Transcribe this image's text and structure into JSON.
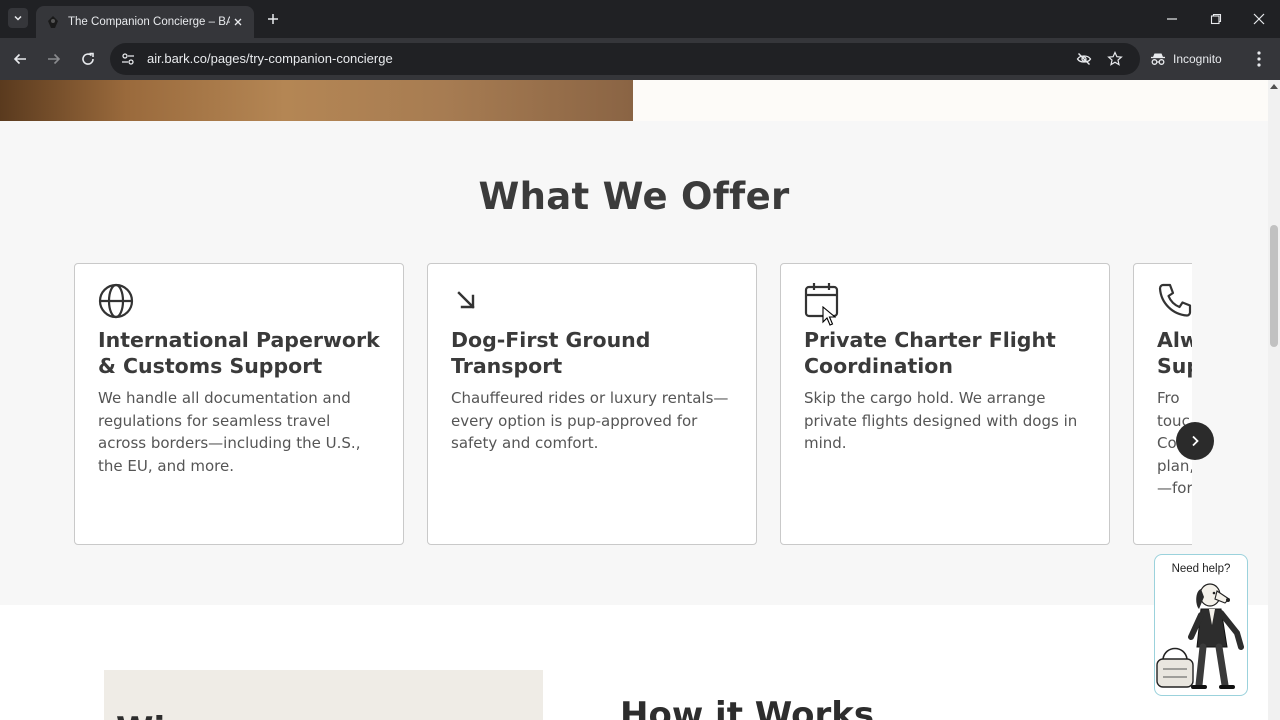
{
  "browser": {
    "tab_title": "The Companion Concierge – BA",
    "url": "air.bark.co/pages/try-companion-concierge",
    "incognito_label": "Incognito"
  },
  "page": {
    "section_title": "What We Offer",
    "cards": [
      {
        "icon": "globe-icon",
        "title": "International Paperwork & Customs Support",
        "text": "We handle all documentation and regulations for seamless travel across borders—including the U.S., the EU, and more."
      },
      {
        "icon": "arrow-down-right-icon",
        "title": "Dog-First Ground Transport",
        "text": "Chauffeured rides or luxury rentals—every option is pup-approved for safety and comfort."
      },
      {
        "icon": "calendar-icon",
        "title": "Private Charter Flight Coordination",
        "text": "Skip the cargo hold. We arrange private flights designed with dogs in mind."
      },
      {
        "icon": "phone-icon",
        "title": "Alw Sup",
        "text": "Fro touc Com plan, —for"
      }
    ],
    "next_section_title": "How it Works",
    "image_peek_text": "Wi",
    "help_label": "Need help?"
  },
  "colors": {
    "chrome_dark": "#202124",
    "chrome_toolbar": "#35363a",
    "section_bg": "#f7f7f7",
    "card_border": "#c9c9c9",
    "title_text": "#3b3b3b",
    "help_border": "#9bd2dc"
  }
}
